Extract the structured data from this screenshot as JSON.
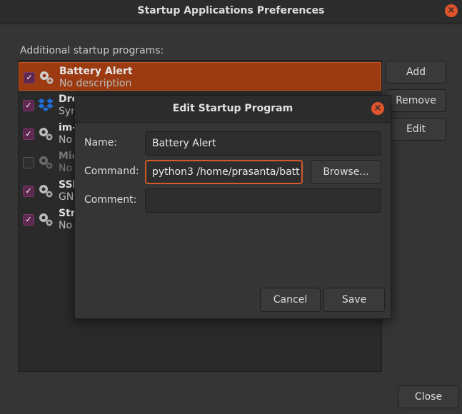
{
  "window": {
    "title": "Startup Applications Preferences",
    "close_glyph": "×"
  },
  "section_label": "Additional startup programs:",
  "programs": [
    {
      "name": "Battery Alert",
      "desc": "No description",
      "checked": true,
      "icon": "gears-icon"
    },
    {
      "name": "Dro",
      "desc": "Syn",
      "checked": true,
      "icon": "dropbox-icon"
    },
    {
      "name": "im-",
      "desc": "No",
      "checked": true,
      "icon": "gears-icon"
    },
    {
      "name": "Mic",
      "desc": "No",
      "checked": false,
      "icon": "gears-icon"
    },
    {
      "name": "SSH",
      "desc": "GN",
      "checked": true,
      "icon": "gears-icon"
    },
    {
      "name": "Str",
      "desc": "No",
      "checked": true,
      "icon": "gears-icon"
    }
  ],
  "side_buttons": {
    "add": "Add",
    "remove": "Remove",
    "edit": "Edit"
  },
  "close_button": "Close",
  "dialog": {
    "title": "Edit Startup Program",
    "name_label": "Name:",
    "name_value": "Battery Alert",
    "command_label": "Command:",
    "command_value": "python3 /home/prasanta/batt",
    "comment_label": "Comment:",
    "comment_value": "",
    "browse": "Browse...",
    "cancel": "Cancel",
    "save": "Save"
  },
  "colors": {
    "accent": "#e0532b",
    "selection": "#9c3b12",
    "checkbox": "#5e2750"
  }
}
